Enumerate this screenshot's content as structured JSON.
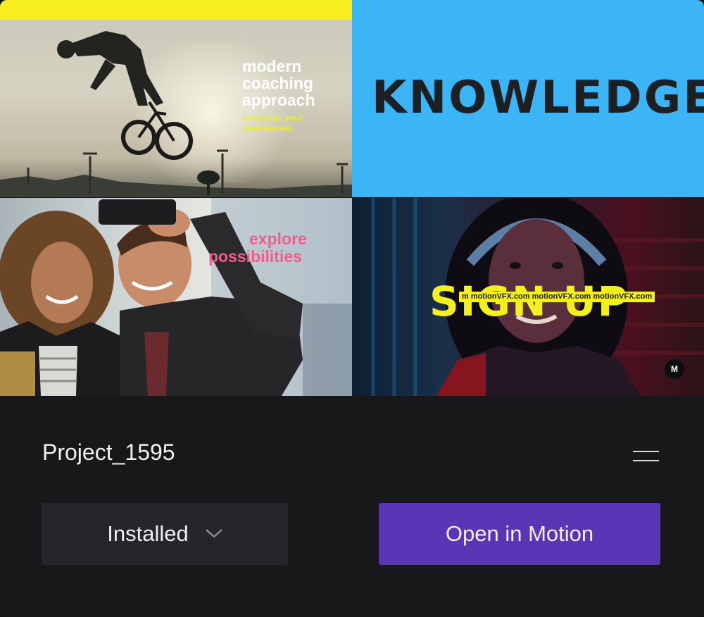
{
  "project": {
    "title": "Project_1595"
  },
  "previews": {
    "bmx": {
      "headline": [
        "modern",
        "coaching",
        "approach"
      ],
      "subline": [
        "overcome your",
        "weaknesses"
      ]
    },
    "knowledge": {
      "headline": "KNOWLEDGE"
    },
    "selfie": {
      "headline": [
        "explore",
        "possibilities"
      ]
    },
    "signup": {
      "headline": "SIGN UP",
      "ticker": "m motionVFX.com motionVFX.com motionVFX.com",
      "badge": "M"
    }
  },
  "actions": {
    "status_select": "Installed",
    "open_button": "Open in Motion"
  },
  "colors": {
    "accent": "#5a35b4",
    "background": "#18181b",
    "yellow": "#f7ee1e",
    "sky": "#3cb5f7"
  },
  "icons": [
    "menu-icon",
    "chevron-down-icon"
  ]
}
